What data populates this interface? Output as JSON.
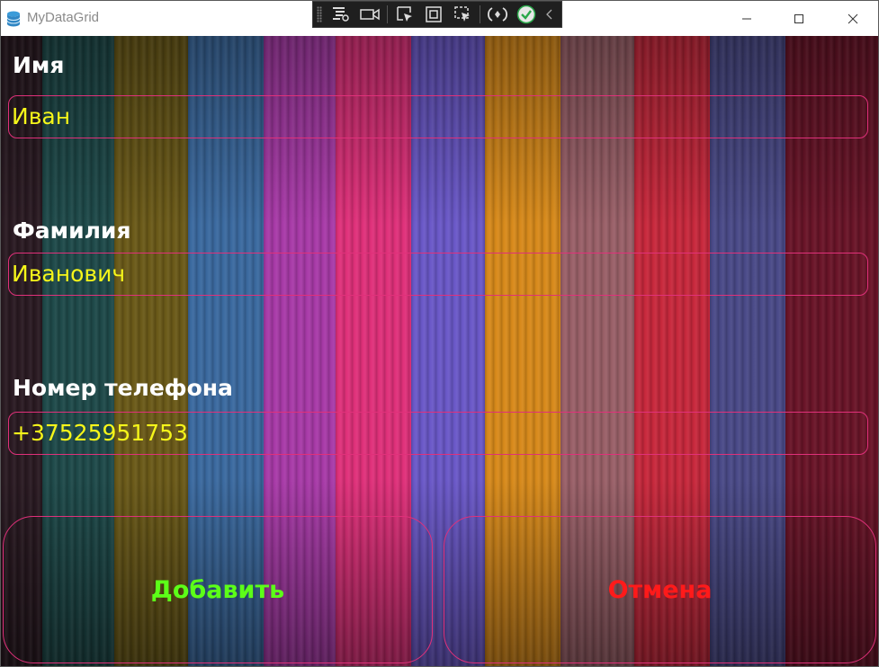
{
  "window": {
    "title": "MyDataGrid",
    "icon": "database-icon",
    "controls": [
      "minimize-icon",
      "maximize-icon",
      "close-icon"
    ]
  },
  "debug_toolbar": {
    "icons": [
      "live-visual-tree-icon",
      "video-camera-icon",
      "select-element-icon",
      "display-layout-adorners-icon",
      "track-focus-icon",
      "hot-reload-icon",
      "checkmark-icon",
      "collapse-chevron-icon"
    ]
  },
  "form": {
    "first_name": {
      "label": "Имя",
      "value": "Иван"
    },
    "last_name": {
      "label": "Фамилия",
      "value": "Иванович"
    },
    "phone": {
      "label": "Номер телефона",
      "value": "+37525951753"
    }
  },
  "buttons": {
    "add_label": "Добавить",
    "cancel_label": "Отмена"
  },
  "colors": {
    "border_accent": "#e0307a",
    "value_text": "#f5f51a",
    "label_text": "#ffffff",
    "add_text": "#5cff18",
    "cancel_text": "#ff1a1a"
  }
}
